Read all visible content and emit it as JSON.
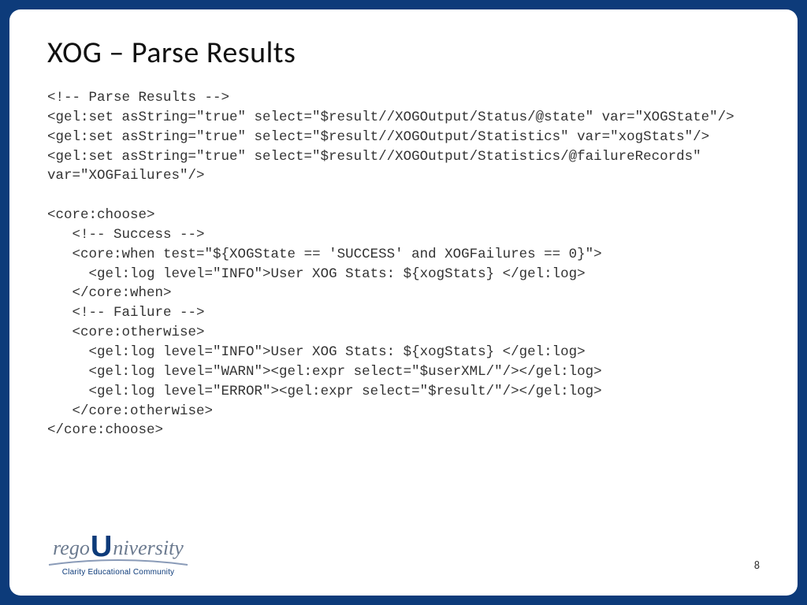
{
  "slide": {
    "title": "XOG – Parse Results",
    "code": "<!-- Parse Results -->\n<gel:set asString=\"true\" select=\"$result//XOGOutput/Status/@state\" var=\"XOGState\"/>\n<gel:set asString=\"true\" select=\"$result//XOGOutput/Statistics\" var=\"xogStats\"/>\n<gel:set asString=\"true\" select=\"$result//XOGOutput/Statistics/@failureRecords\" var=\"XOGFailures\"/>\n\n<core:choose>\n   <!-- Success -->\n   <core:when test=\"${XOGState == 'SUCCESS' and XOGFailures == 0}\">\n     <gel:log level=\"INFO\">User XOG Stats: ${xogStats} </gel:log>\n   </core:when>\n   <!-- Failure -->\n   <core:otherwise>\n     <gel:log level=\"INFO\">User XOG Stats: ${xogStats} </gel:log>\n     <gel:log level=\"WARN\"><gel:expr select=\"$userXML/\"/></gel:log>\n     <gel:log level=\"ERROR\"><gel:expr select=\"$result/\"/></gel:log>\n   </core:otherwise>\n</core:choose>"
  },
  "footer": {
    "logo_prefix": "rego",
    "logo_u": "U",
    "logo_suffix": "niversity",
    "tagline": "Clarity Educational Community",
    "page_number": "8"
  }
}
